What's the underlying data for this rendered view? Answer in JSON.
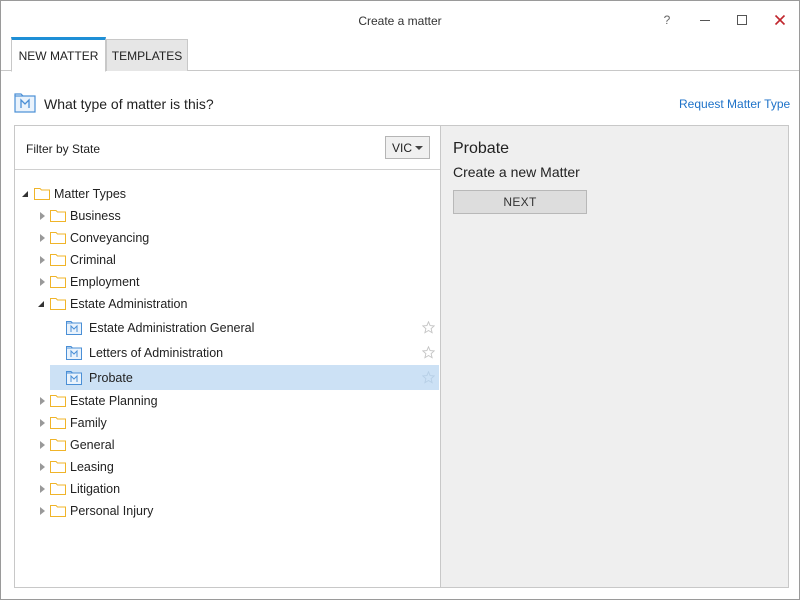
{
  "window": {
    "title": "Create a matter",
    "help_label": "?"
  },
  "tabs": [
    {
      "label": "NEW MATTER",
      "active": true
    },
    {
      "label": "TEMPLATES",
      "active": false
    }
  ],
  "header": {
    "question": "What type of matter is this?",
    "request_link": "Request Matter Type"
  },
  "filter": {
    "label": "Filter by State",
    "selected_state": "VIC"
  },
  "tree": {
    "root": "Matter Types",
    "categories": [
      {
        "label": "Business"
      },
      {
        "label": "Conveyancing"
      },
      {
        "label": "Criminal"
      },
      {
        "label": "Employment"
      },
      {
        "label": "Estate Administration",
        "expanded": true,
        "children": [
          {
            "label": "Estate Administration General"
          },
          {
            "label": "Letters of Administration"
          },
          {
            "label": "Probate",
            "selected": true
          }
        ]
      },
      {
        "label": "Estate Planning"
      },
      {
        "label": "Family"
      },
      {
        "label": "General"
      },
      {
        "label": "Leasing"
      },
      {
        "label": "Litigation"
      },
      {
        "label": "Personal Injury"
      }
    ]
  },
  "detail": {
    "title": "Probate",
    "subtitle": "Create a new Matter",
    "next_label": "NEXT"
  },
  "colors": {
    "accent": "#1e8fd6",
    "folder": "#f0b429",
    "selected_row": "#cce1f5",
    "link": "#1e72c8",
    "matter_icon": "#4a8fd6"
  }
}
